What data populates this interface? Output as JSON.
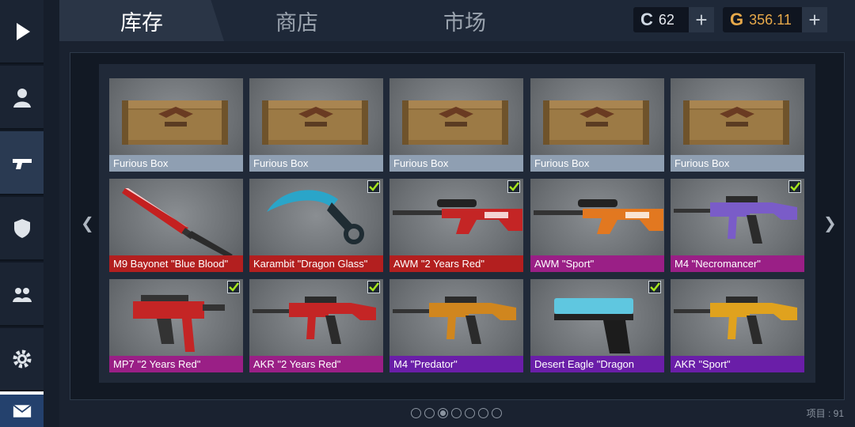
{
  "tabs": [
    {
      "label": "库存",
      "active": true
    },
    {
      "label": "商店",
      "active": false
    },
    {
      "label": "市场",
      "active": false
    }
  ],
  "currency": {
    "coins": {
      "icon": "C",
      "value": "62",
      "color": "#cfd8e3"
    },
    "gold": {
      "icon": "G",
      "value": "356.11",
      "color": "#e7a94a"
    }
  },
  "sidebar": [
    "play-icon",
    "profile-icon",
    "weapon-icon",
    "clan-icon",
    "friends-icon",
    "settings-icon",
    "mail-icon"
  ],
  "items": [
    {
      "name": "Furious Box",
      "rarity_color": "#8f9fb2",
      "checked": false,
      "kind": "box"
    },
    {
      "name": "Furious Box",
      "rarity_color": "#8f9fb2",
      "checked": false,
      "kind": "box"
    },
    {
      "name": "Furious Box",
      "rarity_color": "#8f9fb2",
      "checked": false,
      "kind": "box"
    },
    {
      "name": "Furious Box",
      "rarity_color": "#8f9fb2",
      "checked": false,
      "kind": "box"
    },
    {
      "name": "Furious Box",
      "rarity_color": "#8f9fb2",
      "checked": false,
      "kind": "box"
    },
    {
      "name": "M9 Bayonet \"Blue Blood\"",
      "rarity_color": "#b31f1f",
      "checked": false,
      "kind": "knife"
    },
    {
      "name": "Karambit \"Dragon Glass\"",
      "rarity_color": "#b31f1f",
      "checked": true,
      "kind": "karambit"
    },
    {
      "name": "AWM \"2 Years Red\"",
      "rarity_color": "#b31f1f",
      "checked": true,
      "kind": "sniper"
    },
    {
      "name": "AWM \"Sport\"",
      "rarity_color": "#9a1f86",
      "checked": false,
      "kind": "sniper"
    },
    {
      "name": "M4 \"Necromancer\"",
      "rarity_color": "#9a1f86",
      "checked": true,
      "kind": "rifle"
    },
    {
      "name": "MP7 \"2 Years Red\"",
      "rarity_color": "#9a1f86",
      "checked": true,
      "kind": "smg"
    },
    {
      "name": "AKR \"2 Years Red\"",
      "rarity_color": "#9a1f86",
      "checked": true,
      "kind": "rifle"
    },
    {
      "name": "M4 \"Predator\"",
      "rarity_color": "#6a1ea8",
      "checked": false,
      "kind": "rifle"
    },
    {
      "name": "Desert Eagle \"Dragon",
      "rarity_color": "#6a1ea8",
      "checked": true,
      "kind": "pistol"
    },
    {
      "name": "AKR \"Sport\"",
      "rarity_color": "#6a1ea8",
      "checked": false,
      "kind": "rifle"
    }
  ],
  "pager": {
    "pages": 7,
    "current": 3
  },
  "count_label": "项目 : 91"
}
